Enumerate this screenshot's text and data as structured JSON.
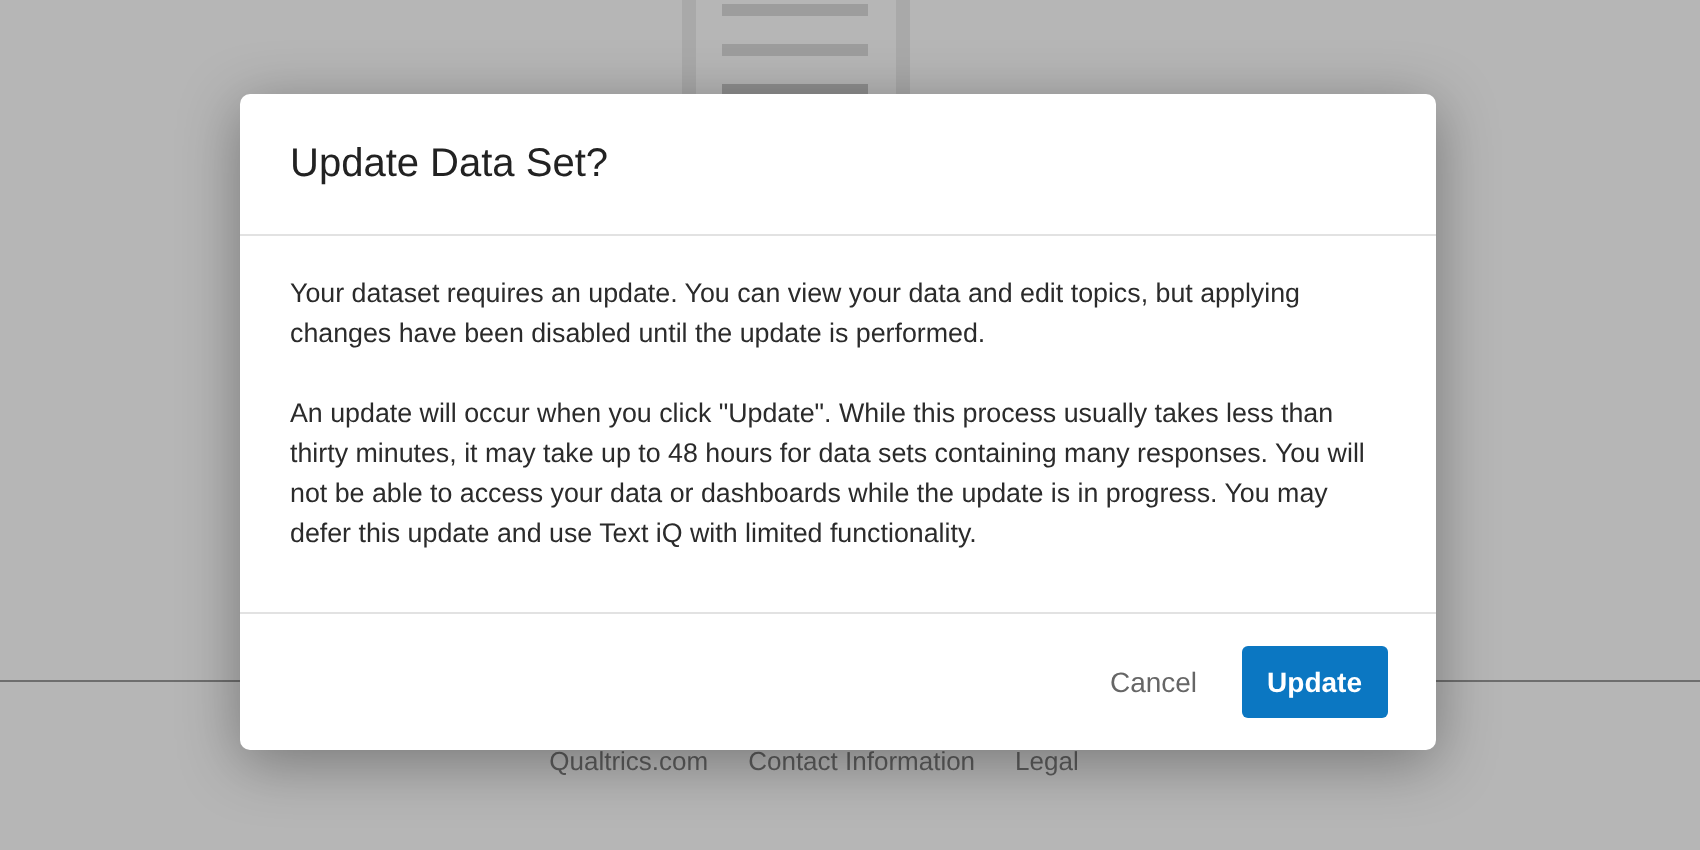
{
  "footer_links": [
    "Qualtrics.com",
    "Contact Information",
    "Legal"
  ],
  "dialog": {
    "title": "Update Data Set?",
    "paragraphs": [
      "Your dataset requires an update. You can view your data and edit topics, but applying changes have been disabled until the update is performed.",
      "An update will occur when you click \"Update\". While this process usually takes less than thirty minutes, it may take up to 48 hours for data sets containing many responses. You will not be able to access your data or dashboards while the update is in progress. You may defer this update and use Text iQ with limited functionality."
    ],
    "buttons": [
      {
        "label": "Cancel",
        "kind": "secondary"
      },
      {
        "label": "Update",
        "kind": "primary"
      }
    ]
  }
}
